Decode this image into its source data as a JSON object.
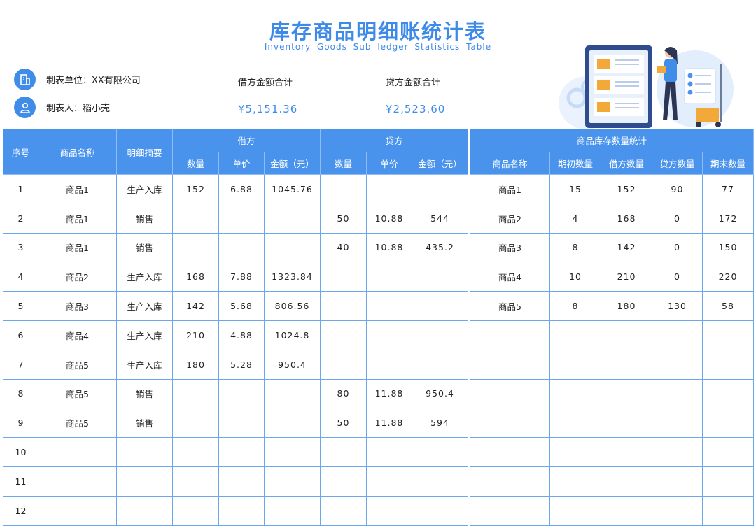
{
  "header": {
    "title": "库存商品明细账统计表",
    "subtitle": "Inventory Goods Sub ledger Statistics Table"
  },
  "info": {
    "unit": "制表单位：XX有限公司",
    "maker": "制表人：稻小壳",
    "debit_total_label": "借方金额合计",
    "debit_total_value": "¥5,151.36",
    "credit_total_label": "贷方金额合计",
    "credit_total_value": "¥2,523.60"
  },
  "colors": {
    "accent": "#3d8ae8",
    "header_bg": "#4a93ec",
    "border": "#6aa8ee"
  },
  "icons": {
    "unit": "building-icon",
    "maker": "user-icon"
  },
  "ledger": {
    "headers": {
      "seq": "序号",
      "name": "商品名称",
      "summary": "明细摘要",
      "debit": "借方",
      "credit": "贷方",
      "qty": "数量",
      "price": "单价",
      "amount": "金额（元）"
    },
    "rows": [
      {
        "seq": "1",
        "name": "商品1",
        "summary": "生产入库",
        "d_qty": "152",
        "d_price": "6.88",
        "d_amt": "1045.76",
        "c_qty": "",
        "c_price": "",
        "c_amt": ""
      },
      {
        "seq": "2",
        "name": "商品1",
        "summary": "销售",
        "d_qty": "",
        "d_price": "",
        "d_amt": "",
        "c_qty": "50",
        "c_price": "10.88",
        "c_amt": "544"
      },
      {
        "seq": "3",
        "name": "商品1",
        "summary": "销售",
        "d_qty": "",
        "d_price": "",
        "d_amt": "",
        "c_qty": "40",
        "c_price": "10.88",
        "c_amt": "435.2"
      },
      {
        "seq": "4",
        "name": "商品2",
        "summary": "生产入库",
        "d_qty": "168",
        "d_price": "7.88",
        "d_amt": "1323.84",
        "c_qty": "",
        "c_price": "",
        "c_amt": ""
      },
      {
        "seq": "5",
        "name": "商品3",
        "summary": "生产入库",
        "d_qty": "142",
        "d_price": "5.68",
        "d_amt": "806.56",
        "c_qty": "",
        "c_price": "",
        "c_amt": ""
      },
      {
        "seq": "6",
        "name": "商品4",
        "summary": "生产入库",
        "d_qty": "210",
        "d_price": "4.88",
        "d_amt": "1024.8",
        "c_qty": "",
        "c_price": "",
        "c_amt": ""
      },
      {
        "seq": "7",
        "name": "商品5",
        "summary": "生产入库",
        "d_qty": "180",
        "d_price": "5.28",
        "d_amt": "950.4",
        "c_qty": "",
        "c_price": "",
        "c_amt": ""
      },
      {
        "seq": "8",
        "name": "商品5",
        "summary": "销售",
        "d_qty": "",
        "d_price": "",
        "d_amt": "",
        "c_qty": "80",
        "c_price": "11.88",
        "c_amt": "950.4"
      },
      {
        "seq": "9",
        "name": "商品5",
        "summary": "销售",
        "d_qty": "",
        "d_price": "",
        "d_amt": "",
        "c_qty": "50",
        "c_price": "11.88",
        "c_amt": "594"
      },
      {
        "seq": "10",
        "name": "",
        "summary": "",
        "d_qty": "",
        "d_price": "",
        "d_amt": "",
        "c_qty": "",
        "c_price": "",
        "c_amt": ""
      },
      {
        "seq": "11",
        "name": "",
        "summary": "",
        "d_qty": "",
        "d_price": "",
        "d_amt": "",
        "c_qty": "",
        "c_price": "",
        "c_amt": ""
      },
      {
        "seq": "12",
        "name": "",
        "summary": "",
        "d_qty": "",
        "d_price": "",
        "d_amt": "",
        "c_qty": "",
        "c_price": "",
        "c_amt": ""
      }
    ]
  },
  "stock": {
    "headers": {
      "group": "商品库存数量统计",
      "name": "商品名称",
      "opening": "期初数量",
      "debit_qty": "借方数量",
      "credit_qty": "贷方数量",
      "closing": "期末数量"
    },
    "rows": [
      {
        "name": "商品1",
        "opening": "15",
        "debit_qty": "152",
        "credit_qty": "90",
        "closing": "77"
      },
      {
        "name": "商品2",
        "opening": "4",
        "debit_qty": "168",
        "credit_qty": "0",
        "closing": "172"
      },
      {
        "name": "商品3",
        "opening": "8",
        "debit_qty": "142",
        "credit_qty": "0",
        "closing": "150"
      },
      {
        "name": "商品4",
        "opening": "10",
        "debit_qty": "210",
        "credit_qty": "0",
        "closing": "220"
      },
      {
        "name": "商品5",
        "opening": "8",
        "debit_qty": "180",
        "credit_qty": "130",
        "closing": "58"
      },
      {
        "name": "",
        "opening": "",
        "debit_qty": "",
        "credit_qty": "",
        "closing": ""
      },
      {
        "name": "",
        "opening": "",
        "debit_qty": "",
        "credit_qty": "",
        "closing": ""
      },
      {
        "name": "",
        "opening": "",
        "debit_qty": "",
        "credit_qty": "",
        "closing": ""
      },
      {
        "name": "",
        "opening": "",
        "debit_qty": "",
        "credit_qty": "",
        "closing": ""
      },
      {
        "name": "",
        "opening": "",
        "debit_qty": "",
        "credit_qty": "",
        "closing": ""
      },
      {
        "name": "",
        "opening": "",
        "debit_qty": "",
        "credit_qty": "",
        "closing": ""
      },
      {
        "name": "",
        "opening": "",
        "debit_qty": "",
        "credit_qty": "",
        "closing": ""
      }
    ]
  }
}
